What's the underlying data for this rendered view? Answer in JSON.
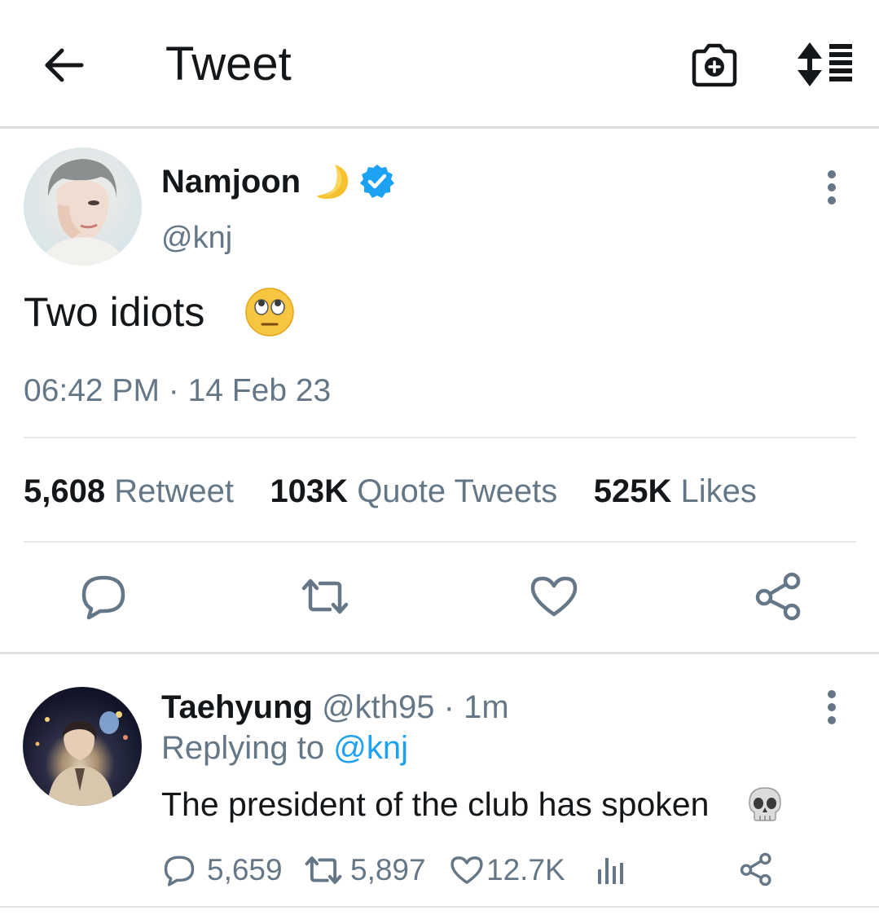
{
  "header": {
    "title": "Tweet",
    "back_icon": "back-arrow-icon",
    "camera_icon": "camera-add-icon",
    "sort_icon": "sort-list-icon"
  },
  "tweet": {
    "author_name": "Namjoon",
    "author_handle": "@knj",
    "verified": true,
    "name_emoji": "crescent-moon",
    "text": "Two idiots",
    "text_emoji": "face-with-rolling-eyes",
    "timestamp": "06:42 PM · 14 Feb 23",
    "stats": [
      {
        "count": "5,608",
        "label": "Retweet"
      },
      {
        "count": "103K",
        "label": "Quote Tweets"
      },
      {
        "count": "525K",
        "label": "Likes"
      }
    ],
    "actions": [
      "reply-icon",
      "retweet-icon",
      "like-icon",
      "share-icon"
    ]
  },
  "reply": {
    "author_name": "Taehyung",
    "author_handle": "@kth95",
    "time": "· 1m",
    "replying_prefix": "Replying to",
    "replying_handle": "@knj",
    "text": "The president of the club has spoken",
    "text_emoji": "skull",
    "reply_count": "5,659",
    "retweet_count": "5,897",
    "like_count": "12.7K"
  },
  "colors": {
    "accent": "#1da1f2",
    "muted_text": "#657786",
    "primary_text": "#14171a",
    "divider": "#e4e8eb"
  }
}
